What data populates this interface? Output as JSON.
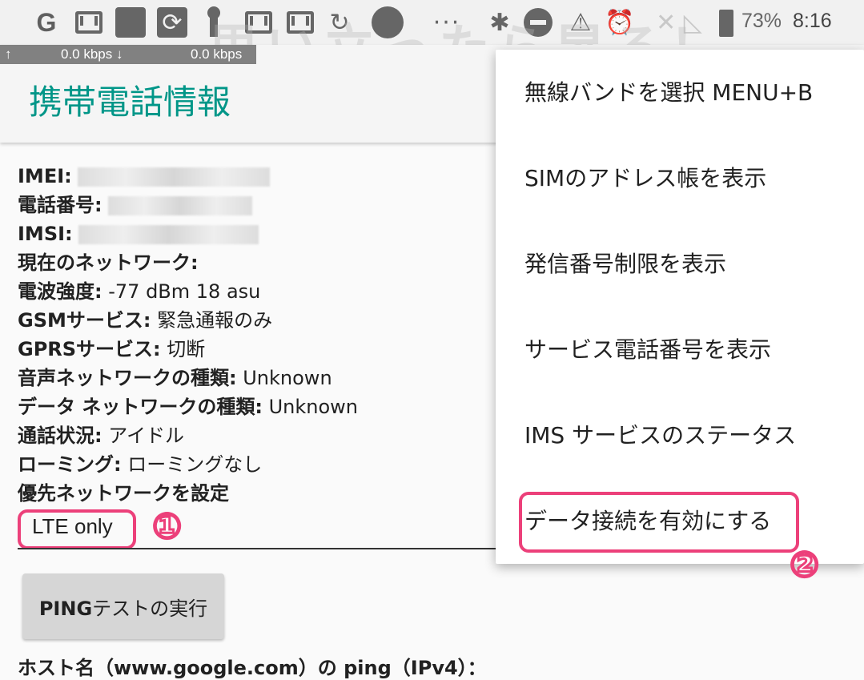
{
  "status_bar": {
    "icons": [
      "google-icon",
      "gmail-icon",
      "gmail-icon",
      "app-icon",
      "sync-icon",
      "pin-icon",
      "gmail-icon",
      "gmail-icon",
      "refresh-icon",
      "blackberry-icon",
      "more-dots-icon",
      "bluetooth-icon",
      "dnd-icon",
      "wifi-off-icon",
      "alarm-icon",
      "no-signal-icon",
      "battery-icon"
    ],
    "g_letter": "G",
    "battery": "73%",
    "time": "8:16",
    "dots": "···"
  },
  "speed": {
    "up": "0.0 kbps ↓",
    "down": "0.0 kbps",
    "arrow": "↑"
  },
  "watermark": "思い立ったら昇る！",
  "app": {
    "title": "携帯電話情報"
  },
  "info": [
    {
      "label": "IMEI:",
      "value": ""
    },
    {
      "label": "電話番号:",
      "value": ""
    },
    {
      "label": "IMSI:",
      "value": ""
    },
    {
      "label": "現在のネットワーク:",
      "value": ""
    },
    {
      "label": "電波強度:",
      "value": " -77 dBm   18 asu"
    },
    {
      "label": "GSMサービス:",
      "value": " 緊急通報のみ"
    },
    {
      "label": "GPRSサービス:",
      "value": " 切断"
    },
    {
      "label": "音声ネットワークの種類:",
      "value": " Unknown"
    },
    {
      "label": "データ ネットワークの種類:",
      "value": " Unknown"
    },
    {
      "label": "通話状況:",
      "value": " アイドル"
    },
    {
      "label": "ローミング:",
      "value": " ローミングなし"
    },
    {
      "label": "優先ネットワークを設定",
      "value": ""
    }
  ],
  "preferred_network": {
    "value": "LTE only"
  },
  "annotations": {
    "one": "①",
    "two": "②"
  },
  "ping": {
    "button_bold": "PING",
    "button_rest": "テストの実行"
  },
  "host_line": "ホスト名（www.google.com）の ping（IPv4）：",
  "menu": {
    "items": [
      "無線バンドを選択   MENU+B",
      "SIMのアドレス帳を表示",
      "発信番号制限を表示",
      "サービス電話番号を表示",
      "IMS サービスのステータス",
      "データ接続を有効にする"
    ]
  },
  "colors": {
    "accent": "#009688",
    "highlight": "#ec407a"
  }
}
